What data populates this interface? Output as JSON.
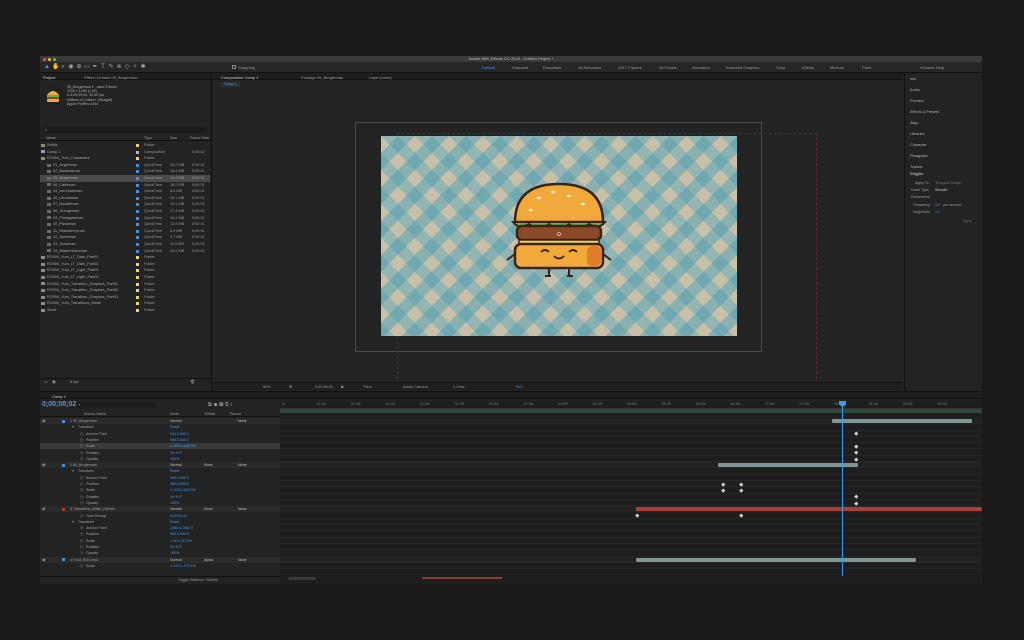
{
  "window": {
    "title": "Adobe After Effects CC 2018 - Untitled Project *"
  },
  "toolbar": {
    "snapping_label": "Snapping",
    "workspaces": [
      "Default",
      "Standard",
      "Essentials",
      "All Animation",
      "2017 Frames",
      "All Panels",
      "Animation",
      "Essential Graphics",
      "Color",
      "Effects",
      "Minimal",
      "Paint"
    ],
    "search_help": "Search Help"
  },
  "project_panel": {
    "tabs": [
      "Project",
      "Effect Controls 05_Burgerman"
    ],
    "selected_item": {
      "name": "05_Burgerman ▾ , used 2 times",
      "line2": "1200 x 1200 (1.00)",
      "line3": "Δ 0;00;00;00, 30.00 fps",
      "line4": "Millions of Colors+ (Straight)",
      "line5": "Apple ProRes 4444"
    },
    "columns": [
      "Name",
      "Type",
      "Size",
      "Frame Rate"
    ],
    "rows": [
      {
        "name": "Solids",
        "type": "Folder",
        "size": "",
        "dur": "",
        "color": "#e8d27a",
        "sel": false,
        "indent": 0
      },
      {
        "name": "Comp 1",
        "type": "Composition",
        "size": "",
        "dur": "0:00:10",
        "color": "#b0b0d8",
        "sel": false,
        "indent": 0
      },
      {
        "name": "RO004_Yum_Characters",
        "type": "Folder",
        "size": "",
        "dur": "",
        "color": "#e8d27a",
        "sel": false,
        "indent": 0
      },
      {
        "name": "01_Avgdvman",
        "type": "QuickTime",
        "size": "13.2 MB",
        "dur": "0:00:01",
        "color": "#4a8fd4",
        "sel": false,
        "indent": 1
      },
      {
        "name": "02_Bananaman",
        "type": "QuickTime",
        "size": "16.4 MB",
        "dur": "0:00:01",
        "color": "#4a8fd4",
        "sel": false,
        "indent": 1
      },
      {
        "name": "05_Burgerman",
        "type": "QuickTime",
        "size": "16.0 MB",
        "dur": "0:00:01",
        "color": "#4a8fd4",
        "sel": true,
        "indent": 1
      },
      {
        "name": "06_Cakeman",
        "type": "QuickTime",
        "size": "16.2 MB",
        "dur": "0:00:01",
        "color": "#4a8fd4",
        "sel": false,
        "indent": 1
      },
      {
        "name": "04_Icecreamman",
        "type": "QuickTime",
        "size": "8.5 MB",
        "dur": "0:00:01",
        "color": "#4a8fd4",
        "sel": false,
        "indent": 1
      },
      {
        "name": "06_Lemonman",
        "type": "QuickTime",
        "size": "15.1 MB",
        "dur": "0:00:01",
        "color": "#4a8fd4",
        "sel": false,
        "indent": 1
      },
      {
        "name": "07_Noodleman",
        "type": "QuickTime",
        "size": "19.1 MB",
        "dur": "0:00:01",
        "color": "#4a8fd4",
        "sel": false,
        "indent": 1
      },
      {
        "name": "08_Orangeman",
        "type": "QuickTime",
        "size": "17.4 MB",
        "dur": "0:00:01",
        "color": "#4a8fd4",
        "sel": false,
        "indent": 1
      },
      {
        "name": "09_Pineappleman",
        "type": "QuickTime",
        "size": "16.1 MB",
        "dur": "0:00:01",
        "color": "#4a8fd4",
        "sel": false,
        "indent": 1
      },
      {
        "name": "10_Pizzaman",
        "type": "QuickTime",
        "size": "13.9 MB",
        "dur": "0:00:01",
        "color": "#4a8fd4",
        "sel": false,
        "indent": 1
      },
      {
        "name": "11_Strawberryman",
        "type": "QuickTime",
        "size": "8.9 MB",
        "dur": "0:00:01",
        "color": "#4a8fd4",
        "sel": false,
        "indent": 1
      },
      {
        "name": "12_Sushiman",
        "type": "QuickTime",
        "size": "9.7 MB",
        "dur": "0:00:01",
        "color": "#4a8fd4",
        "sel": false,
        "indent": 1
      },
      {
        "name": "13_Toastman",
        "type": "QuickTime",
        "size": "11.5 MB",
        "dur": "0:00:01",
        "color": "#4a8fd4",
        "sel": false,
        "indent": 1
      },
      {
        "name": "14_Watermelonman",
        "type": "QuickTime",
        "size": "10.6 MB",
        "dur": "0:00:01",
        "color": "#4a8fd4",
        "sel": false,
        "indent": 1
      },
      {
        "name": "RO004_Yum_LT_Dark_Part01",
        "type": "Folder",
        "size": "",
        "dur": "",
        "color": "#e8d27a",
        "sel": false,
        "indent": 0
      },
      {
        "name": "RO004_Yum_LT_Dark_Part02",
        "type": "Folder",
        "size": "",
        "dur": "",
        "color": "#e8d27a",
        "sel": false,
        "indent": 0
      },
      {
        "name": "RO004_Yum_LT_Light_Part01",
        "type": "Folder",
        "size": "",
        "dur": "",
        "color": "#e8d27a",
        "sel": false,
        "indent": 0
      },
      {
        "name": "RO004_Yum_LT_Light_Part02",
        "type": "Folder",
        "size": "",
        "dur": "",
        "color": "#e8d27a",
        "sel": false,
        "indent": 0
      },
      {
        "name": "RO004_Yum_Transition_Graphics_Part01",
        "type": "Folder",
        "size": "",
        "dur": "",
        "color": "#e8d27a",
        "sel": false,
        "indent": 0
      },
      {
        "name": "RO004_Yum_Transition_Graphics_Part02",
        "type": "Folder",
        "size": "",
        "dur": "",
        "color": "#e8d27a",
        "sel": false,
        "indent": 0
      },
      {
        "name": "RO004_Yum_Transition_Graphics_Part03",
        "type": "Folder",
        "size": "",
        "dur": "",
        "color": "#e8d27a",
        "sel": false,
        "indent": 0
      },
      {
        "name": "RO004_Yum_Transitions_Matte",
        "type": "Folder",
        "size": "",
        "dur": "",
        "color": "#e8d27a",
        "sel": false,
        "indent": 0
      },
      {
        "name": "Stock",
        "type": "Folder",
        "size": "",
        "dur": "",
        "color": "#e8d27a",
        "sel": false,
        "indent": 0
      }
    ],
    "bpc": "8 bpc"
  },
  "comp_panel": {
    "tabs": [
      "Composition Comp 1",
      "Footage 05_Burgerman",
      "Layer (none)"
    ],
    "breadcrumb": "Comp 1",
    "zoom": "50%",
    "timecode": "0;00;08;02",
    "resolution": "Third",
    "camera": "Active Camera",
    "views": "1 View",
    "offset": "+0.0"
  },
  "right_panel": {
    "items": [
      "Info",
      "Audio",
      "Preview",
      "Effects & Presets",
      "Align",
      "Libraries",
      "Character",
      "Paragraph",
      "Tracker"
    ],
    "wiggler": {
      "title": "Wiggler",
      "apply_to_label": "Apply To",
      "apply_to_value": "Temporal Graph",
      "noise_type_label": "Noise Type",
      "noise_type_value": "Smooth",
      "dimensions_label": "Dimensions",
      "frequency_label": "Frequency",
      "frequency_value": "5.0",
      "frequency_unit": "per second",
      "magnitude_label": "Magnitude",
      "magnitude_value": "1.0",
      "apply_button": "Apply"
    }
  },
  "timeline": {
    "tab": "Comp 1",
    "timecode": "0;00;08;02",
    "columns": [
      "Source Name",
      "Mode",
      "TrkMat",
      "Parent"
    ],
    "toggle_label": "Toggle Switches / Modes",
    "ruler_ticks": [
      "0f",
      "00:15f",
      "01:00f",
      "01:15f",
      "02:00f",
      "02:15f",
      "03:00f",
      "03:15f",
      "04:00f",
      "04:15f",
      "05:00f",
      "05:15f",
      "06:00f",
      "06:15f",
      "07:00f",
      "07:15f",
      "08:00f",
      "08:15f",
      "09:00f",
      "09:15f"
    ],
    "rows": [
      {
        "label": "1   05_Burgerman",
        "kind": "layer",
        "value": "Normal",
        "parent": "None"
      },
      {
        "label": "Transform",
        "kind": "group",
        "value": "Reset"
      },
      {
        "label": "Anchor Point",
        "kind": "prop",
        "value": "540.0,540.0"
      },
      {
        "label": "Position",
        "kind": "prop",
        "value": "960.0,540.0"
      },
      {
        "label": "Scale",
        "kind": "prop-sel",
        "value": "∞ 100.0,100.0%"
      },
      {
        "label": "Rotation",
        "kind": "prop",
        "value": "0x+0.0°"
      },
      {
        "label": "Opacity",
        "kind": "prop",
        "value": "100%"
      },
      {
        "label": "2   05_Burgerman",
        "kind": "layer",
        "value": "Normal",
        "trk": "None",
        "parent": "None"
      },
      {
        "label": "Transform",
        "kind": "group",
        "value": "Reset"
      },
      {
        "label": "Anchor Point",
        "kind": "prop",
        "value": "540.0,540.0"
      },
      {
        "label": "Position",
        "kind": "prop-kf",
        "value": "960.0,540.0"
      },
      {
        "label": "Scale",
        "kind": "prop-kf",
        "value": "∞ 100.0,100.0%"
      },
      {
        "label": "Rotation",
        "kind": "prop",
        "value": "0x+0.0°"
      },
      {
        "label": "Opacity",
        "kind": "prop",
        "value": "100%"
      },
      {
        "label": "3   Transitions_Matte_Kitchen",
        "kind": "layer",
        "value": "Normal",
        "trk": "None",
        "parent": "None"
      },
      {
        "label": "Time Remap",
        "kind": "prop-kf",
        "value": "0;00;01;15"
      },
      {
        "label": "Transform",
        "kind": "group",
        "value": "Reset"
      },
      {
        "label": "Anchor Point",
        "kind": "prop",
        "value": "1280.0,1080.0"
      },
      {
        "label": "Position",
        "kind": "prop",
        "value": "960.0,540.0"
      },
      {
        "label": "Scale",
        "kind": "prop",
        "value": "∞ 50.0,50.0%"
      },
      {
        "label": "Rotation",
        "kind": "prop",
        "value": "0x+0.0°"
      },
      {
        "label": "Opacity",
        "kind": "prop",
        "value": "100%"
      },
      {
        "label": "4   Food_BG3.mp4",
        "kind": "layer",
        "value": "Normal",
        "trk": "Alpha",
        "parent": "None"
      },
      {
        "label": "Scale",
        "kind": "prop",
        "value": "∞ 173.1,173.1%"
      }
    ]
  },
  "colors": {
    "accent": "#3d9cf0",
    "bar_green": "#4b7a5a",
    "bar_gray": "#7e9593",
    "bar_red": "#a8413a",
    "bg_teal": "#6fa8b0",
    "bg_cream": "#c8c0a8",
    "burger_bun": "#f2a93b",
    "burger_outline": "#3a2418"
  }
}
